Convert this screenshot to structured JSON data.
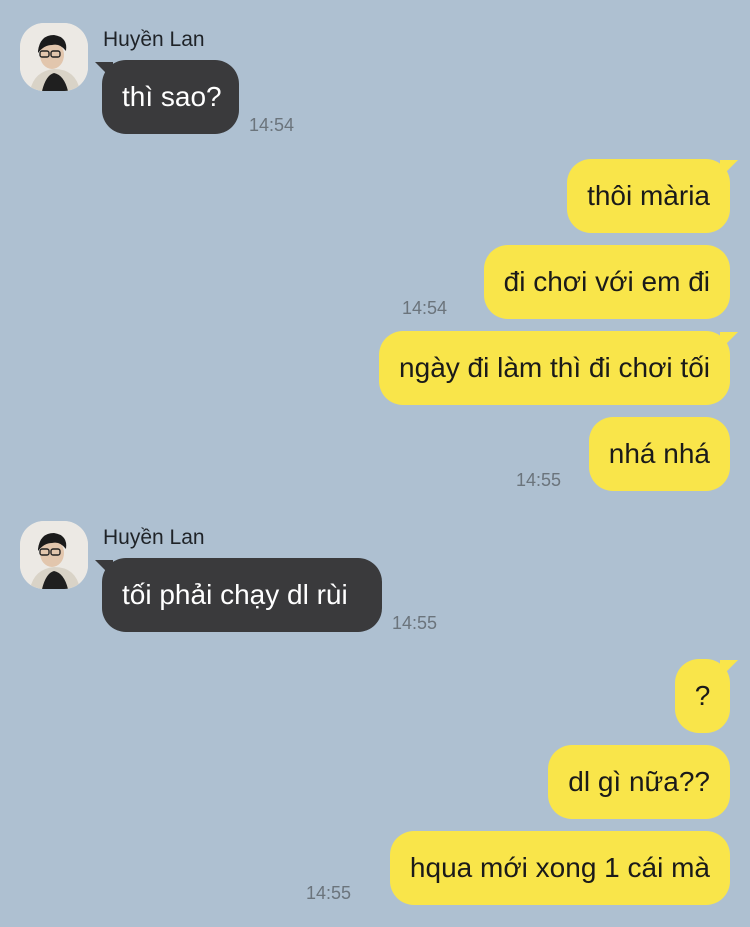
{
  "messages": {
    "sender_1": "Huyền Lan",
    "in_1": "thì sao?",
    "time_1": "14:54",
    "out_1": "thôi mària",
    "out_2": "đi chơi với em đi",
    "time_2": "14:54",
    "out_3": "ngày đi làm thì đi chơi tối",
    "out_4": "nhá nhá",
    "time_3": "14:55",
    "sender_2": "Huyền Lan",
    "in_2": "tối phải chạy dl rùi",
    "time_4": "14:55",
    "out_5": "?",
    "out_6": "dl gì nữa??",
    "out_7": "hqua mới xong 1 cái mà",
    "time_5": "14:55"
  },
  "colors": {
    "background": "#aec0d1",
    "incoming_bubble": "#3a3a3c",
    "outgoing_bubble": "#f9e54a",
    "timestamp": "#6b747c"
  },
  "icons": {
    "avatar": "user-avatar-photo"
  }
}
